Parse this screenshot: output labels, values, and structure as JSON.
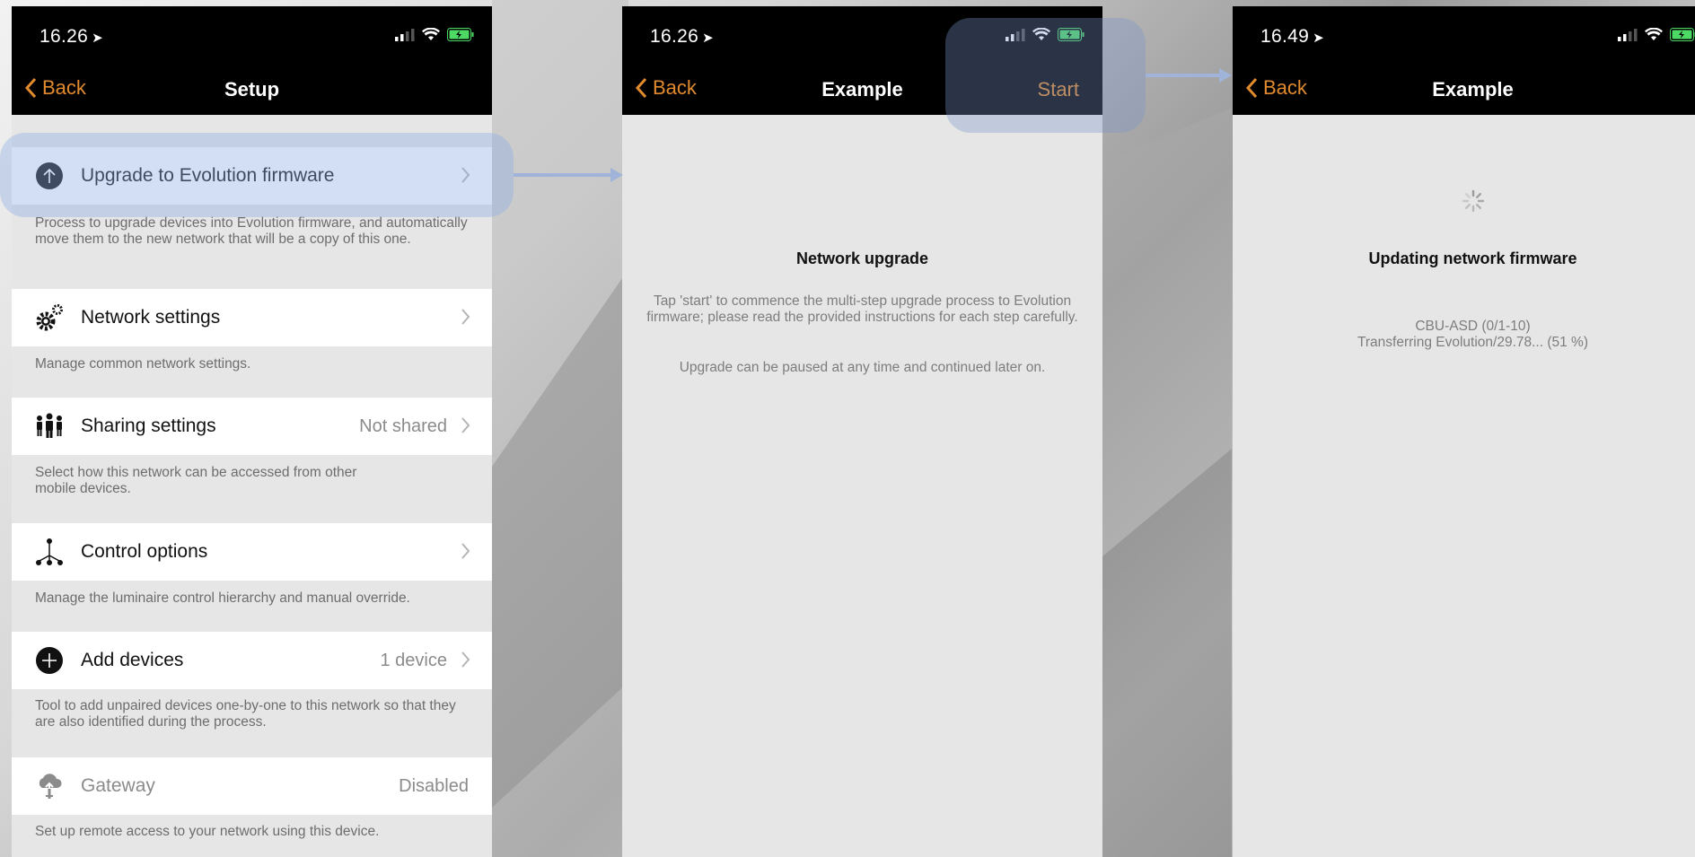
{
  "colors": {
    "accent": "#e28a2e",
    "bar": "#000000",
    "panel": "#e6e6e6",
    "battery": "#4cd964"
  },
  "screen1": {
    "time": "16.26",
    "back_label": "Back",
    "title": "Setup",
    "items": [
      {
        "label": "Upgrade to Evolution firmware",
        "value": "",
        "icon": "arrow-up-circle-icon",
        "desc": "Process to upgrade devices into Evolution firmware, and automatically move them to the new network that will be a copy of this one."
      },
      {
        "label": "Network settings",
        "value": "",
        "icon": "gears-icon",
        "desc": "Manage common network settings."
      },
      {
        "label": "Sharing settings",
        "value": "Not shared",
        "icon": "people-icon",
        "desc": "Select how this network can be accessed from other mobile devices."
      },
      {
        "label": "Control options",
        "value": "",
        "icon": "hierarchy-icon",
        "desc": "Manage the luminaire control hierarchy and manual override."
      },
      {
        "label": "Add devices",
        "value": "1 device",
        "icon": "plus-circle-icon",
        "desc": "Tool to add unpaired devices one-by-one to this network so that they are also identified during the process."
      },
      {
        "label": "Gateway",
        "value": "Disabled",
        "icon": "cloud-upload-icon",
        "desc": "Set up remote access to your network using this device."
      }
    ]
  },
  "screen2": {
    "time": "16.26",
    "back_label": "Back",
    "title": "Example",
    "start_label": "Start",
    "heading": "Network upgrade",
    "body": "Tap 'start' to commence the multi-step upgrade process to Evolution firmware; please read the provided instructions for each step carefully.",
    "note": "Upgrade can be paused at any time and continued later on."
  },
  "screen3": {
    "time": "16.49",
    "back_label": "Back",
    "title": "Example",
    "heading": "Updating network firmware",
    "device": "CBU-ASD (0/1-10)",
    "progress_text": "Transferring Evolution/29.78... (51 %)",
    "progress_percent": 51
  }
}
